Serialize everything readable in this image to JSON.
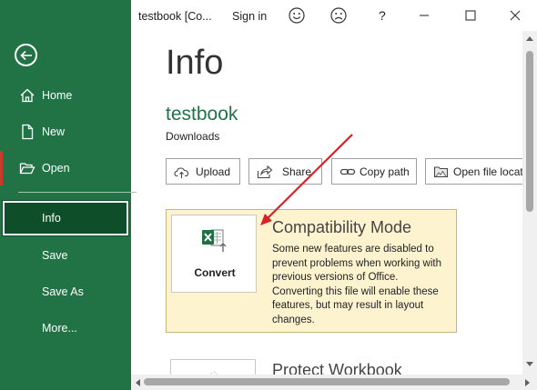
{
  "window": {
    "title": "testbook  [Co...",
    "sign_in": "Sign in",
    "help": "?"
  },
  "sidebar": {
    "items": [
      {
        "label": "Home",
        "icon": "home-icon"
      },
      {
        "label": "New",
        "icon": "new-file-icon"
      },
      {
        "label": "Open",
        "icon": "folder-open-icon"
      },
      {
        "label": "Info",
        "active": true
      },
      {
        "label": "Save"
      },
      {
        "label": "Save As"
      },
      {
        "label": "More..."
      }
    ]
  },
  "main": {
    "title": "Info",
    "file_name": "testbook",
    "file_location": "Downloads",
    "actions": [
      {
        "label": "Upload",
        "icon": "cloud-upload-icon"
      },
      {
        "label": "Share",
        "icon": "share-icon"
      },
      {
        "label": "Copy path",
        "icon": "link-icon"
      },
      {
        "label": "Open file location",
        "icon": "folder-location-icon"
      }
    ],
    "compatibility": {
      "button_label": "Convert",
      "title": "Compatibility Mode",
      "description": "Some new features are disabled to prevent problems when working with previous versions of Office. Converting this file will enable these features, but may result in layout changes."
    },
    "protect": {
      "title": "Protect Workbook"
    }
  },
  "colors": {
    "sidebar_bg": "#217346",
    "active_item_bg": "#0e4e28",
    "accent_text": "#217346",
    "compat_panel_bg": "#fdf4cf",
    "annotation_arrow": "#d9232a"
  }
}
